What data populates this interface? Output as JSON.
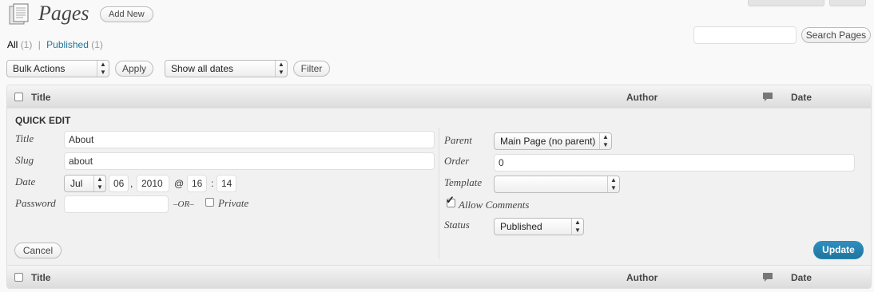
{
  "header": {
    "title": "Pages",
    "add_new_label": "Add New"
  },
  "filters": {
    "all_label": "All",
    "all_count": "(1)",
    "separator": "|",
    "published_label": "Published",
    "published_count": "(1)"
  },
  "search": {
    "value": "",
    "button_label": "Search Pages"
  },
  "bulk": {
    "action_selected": "Bulk Actions",
    "apply_label": "Apply",
    "dates_selected": "Show all dates",
    "filter_label": "Filter"
  },
  "table": {
    "columns": {
      "title": "Title",
      "author": "Author",
      "comments_icon": "comment-bubble-icon",
      "date": "Date"
    }
  },
  "quick_edit": {
    "heading": "QUICK EDIT",
    "title_label": "Title",
    "title_value": "About",
    "slug_label": "Slug",
    "slug_value": "about",
    "date_label": "Date",
    "month": "Jul",
    "day": "06",
    "comma": ",",
    "year": "2010",
    "at": "@",
    "hour": "16",
    "colon": ":",
    "minute": "14",
    "password_label": "Password",
    "password_value": "",
    "or_text": "–OR–",
    "private_label": "Private",
    "private_checked": false,
    "parent_label": "Parent",
    "parent_selected": "Main Page (no parent)",
    "order_label": "Order",
    "order_value": "0",
    "template_label": "Template",
    "template_selected": "",
    "allow_comments_label": "Allow Comments",
    "allow_comments_checked": true,
    "status_label": "Status",
    "status_selected": "Published",
    "cancel_label": "Cancel",
    "update_label": "Update"
  },
  "colors": {
    "link": "#21759b",
    "primary_button": "#21759b",
    "background": "#f9f9f9"
  }
}
